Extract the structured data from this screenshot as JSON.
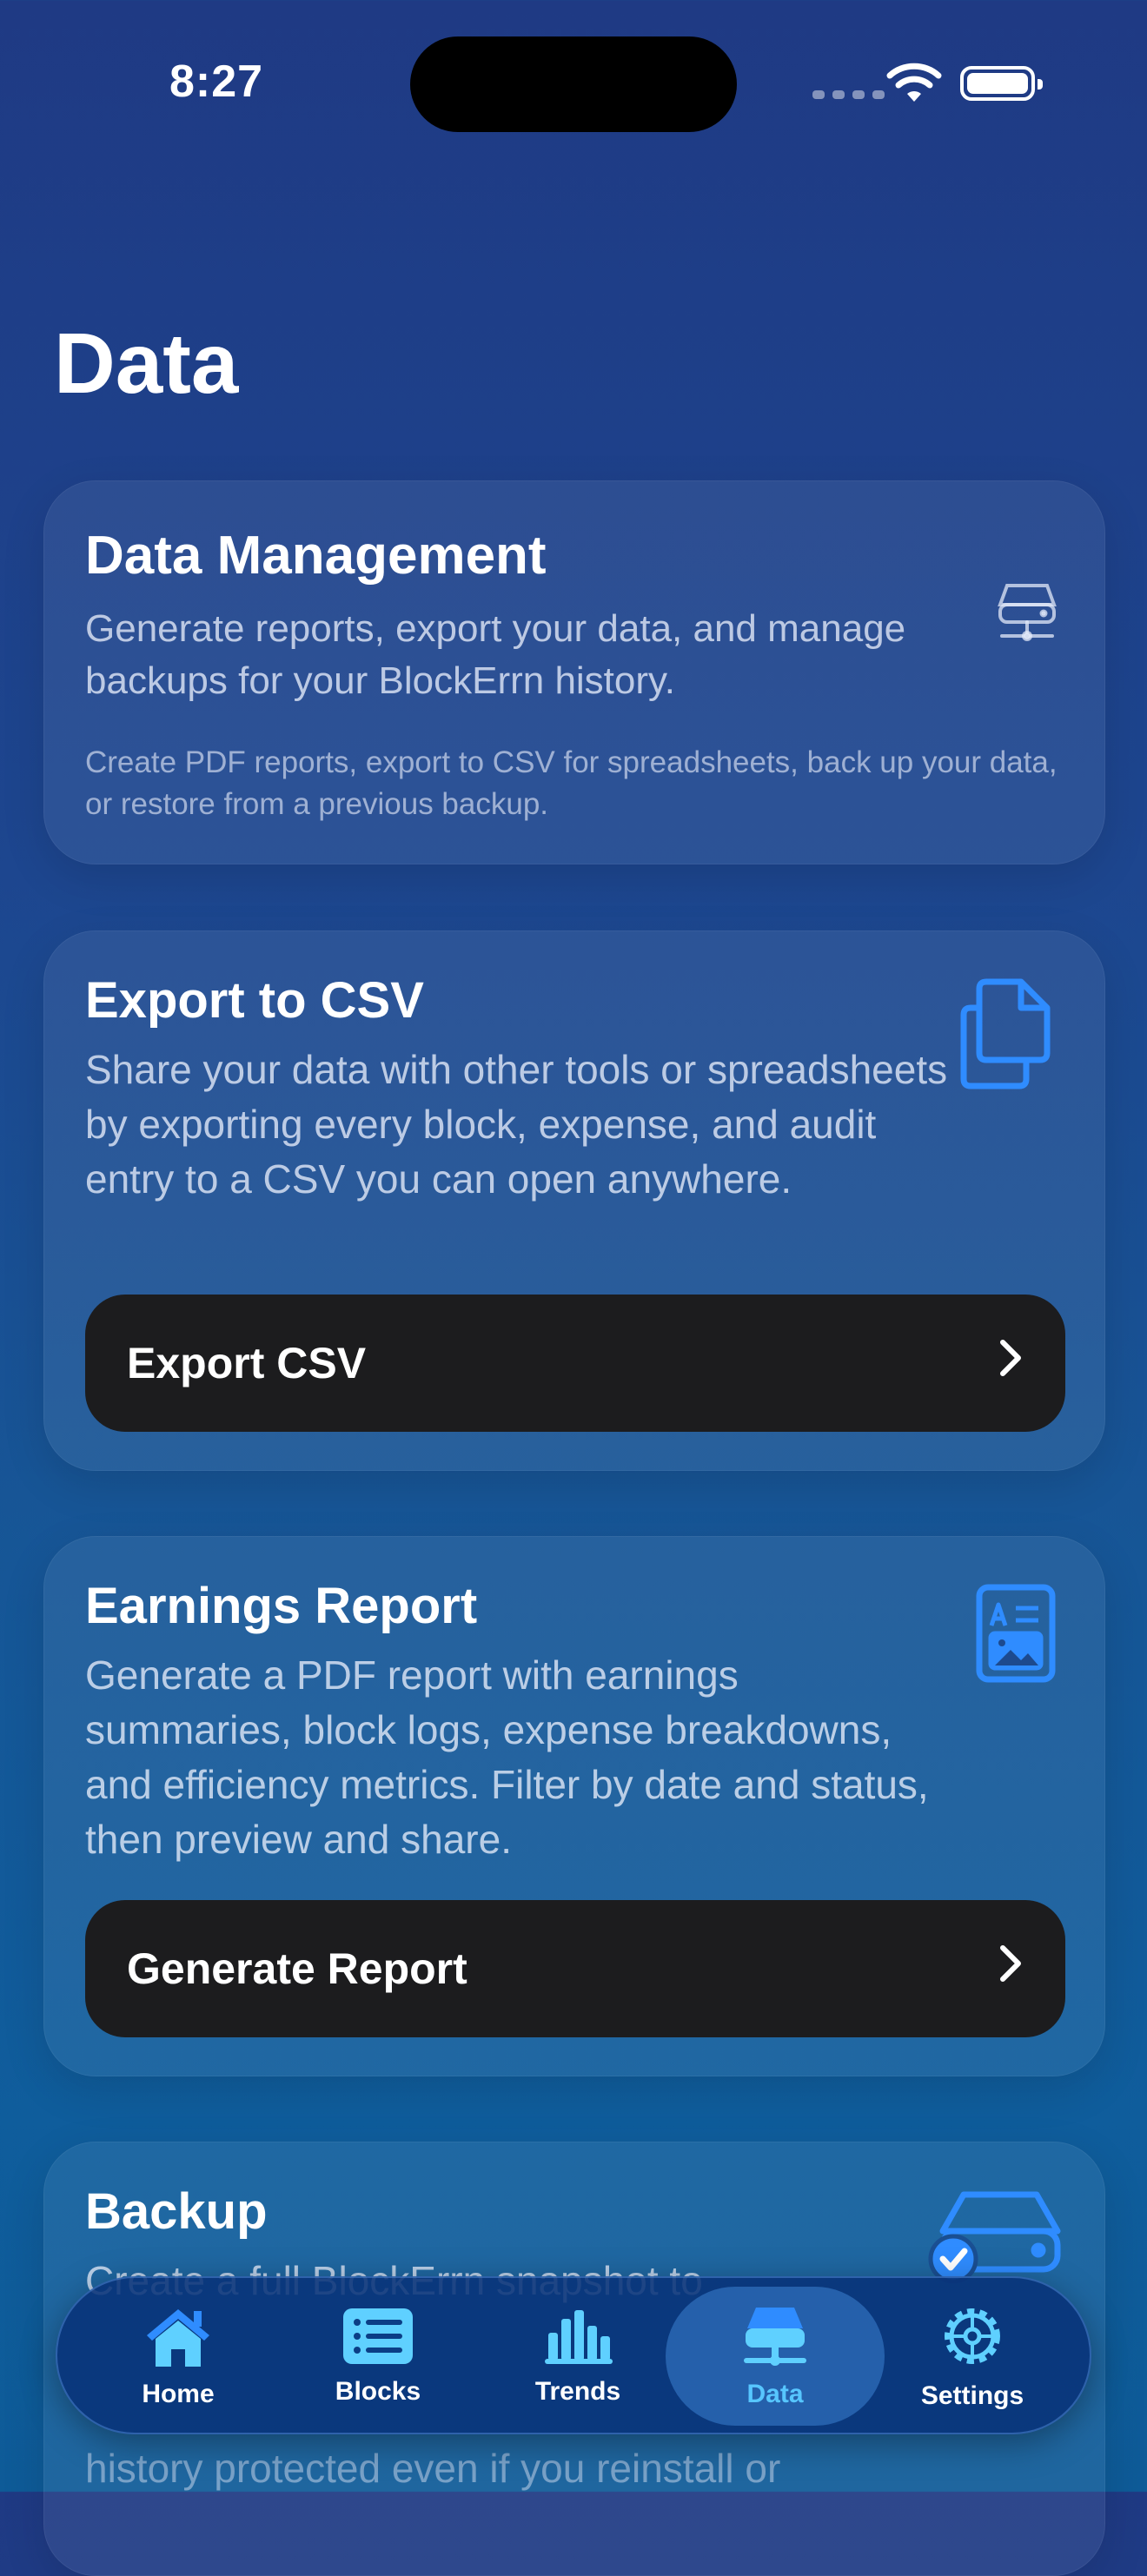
{
  "status_bar": {
    "time": "8:27"
  },
  "page": {
    "title": "Data"
  },
  "cards": {
    "management": {
      "title": "Data Management",
      "body": "Generate reports, export your data, and manage backups for your BlockErrn history.",
      "note": "Create PDF reports, export to CSV for spreadsheets, back up your data, or restore from a previous backup.",
      "icon": "server-icon"
    },
    "export": {
      "title": "Export to CSV",
      "body": "Share your data with other tools or spreadsheets by exporting every block, expense, and audit entry to a CSV you can open anywhere.",
      "button": "Export CSV",
      "icon": "documents-icon"
    },
    "report": {
      "title": "Earnings Report",
      "body": "Generate a PDF report with earnings summaries, block logs, expense breakdowns, and efficiency metrics. Filter by date and status, then preview and share.",
      "button": "Generate Report",
      "icon": "report-icon"
    },
    "backup": {
      "title": "Backup",
      "body_partial_top": "Create a full BlockErrn snapshot to",
      "body_partial_bottom": "history protected even if you reinstall or",
      "icon": "drive-check-icon"
    }
  },
  "tabbar": {
    "items": [
      {
        "label": "Home",
        "icon": "house-icon"
      },
      {
        "label": "Blocks",
        "icon": "list-icon"
      },
      {
        "label": "Trends",
        "icon": "bar-chart-icon"
      },
      {
        "label": "Data",
        "icon": "server-icon"
      },
      {
        "label": "Settings",
        "icon": "gear-icon"
      }
    ],
    "active": "Data"
  },
  "colors": {
    "accent": "#2f8cff",
    "active_tab": "#57c6ff",
    "button_bg": "#1c1c1e"
  }
}
